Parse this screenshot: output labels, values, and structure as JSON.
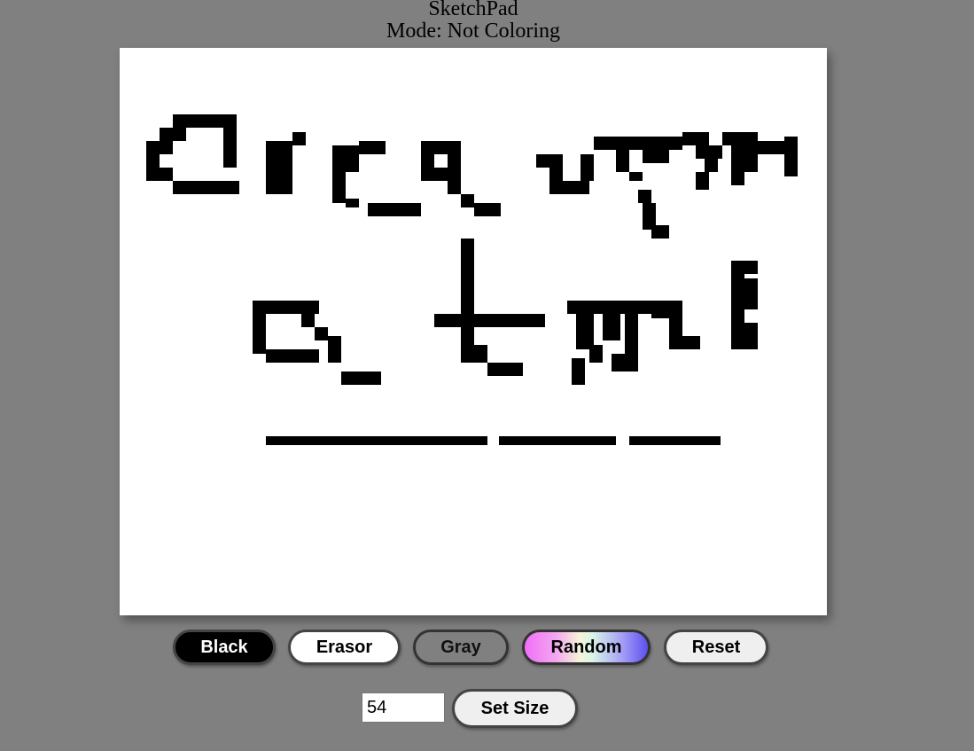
{
  "header": {
    "title": "SketchPad",
    "mode_text": "Mode: Not Coloring"
  },
  "canvas": {
    "background": "#ffffff",
    "ink_color": "#000000",
    "grid_size": 54
  },
  "controls": {
    "color_buttons": {
      "black_label": "Black",
      "erasor_label": "Erasor",
      "gray_label": "Gray",
      "random_label": "Random",
      "reset_label": "Reset"
    },
    "size": {
      "input_value": "54",
      "set_size_label": "Set Size"
    }
  }
}
